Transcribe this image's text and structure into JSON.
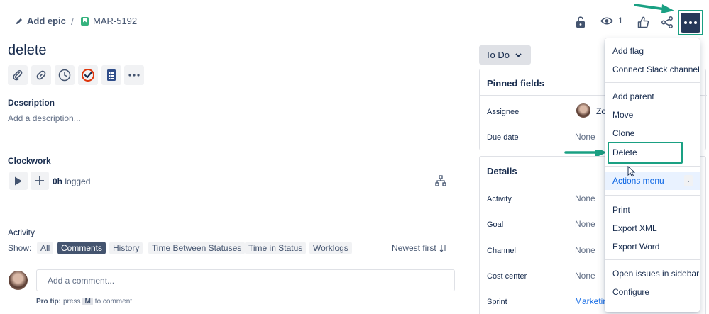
{
  "breadcrumb": {
    "add_epic": "Add epic",
    "separator": "/",
    "issue_key": "MAR-5192"
  },
  "issue": {
    "title": "delete"
  },
  "header_actions": {
    "watchers_count": "1"
  },
  "description": {
    "heading": "Description",
    "placeholder": "Add a description..."
  },
  "clockwork": {
    "heading": "Clockwork",
    "logged_value": "0h",
    "logged_label": "logged"
  },
  "activity": {
    "heading": "Activity",
    "show_label": "Show:",
    "tabs": [
      "All",
      "Comments",
      "History",
      "Time Between Statuses",
      "Time in Status",
      "Worklogs"
    ],
    "active_tab": "Comments",
    "sort": "Newest first",
    "comment_placeholder": "Add a comment...",
    "pro_tip_prefix": "Pro tip:",
    "pro_tip_press": "press",
    "pro_tip_key": "M",
    "pro_tip_suffix": "to comment"
  },
  "status": {
    "label": "To Do"
  },
  "pinned": {
    "heading": "Pinned fields",
    "fields": [
      {
        "label": "Assignee",
        "value": "Zo"
      },
      {
        "label": "Due date",
        "value": "None"
      }
    ]
  },
  "details": {
    "heading": "Details",
    "fields": [
      {
        "label": "Activity",
        "value": "None"
      },
      {
        "label": "Goal",
        "value": "None"
      },
      {
        "label": "Channel",
        "value": "None"
      },
      {
        "label": "Cost center",
        "value": "None"
      },
      {
        "label": "Sprint",
        "value": "Marketin"
      }
    ]
  },
  "more_menu": {
    "items": [
      "Add flag",
      "Connect Slack channel",
      "Add parent",
      "Move",
      "Clone",
      "Delete",
      "Actions menu",
      "Print",
      "Export XML",
      "Export Word",
      "Open issues in sidebar",
      "Configure"
    ],
    "actions_shortcut": ".",
    "highlighted": "Actions menu"
  },
  "colors": {
    "annotation": "#1aa083",
    "more_button": "#253858",
    "active_chip": "#44546f",
    "link": "#0c66e4"
  }
}
